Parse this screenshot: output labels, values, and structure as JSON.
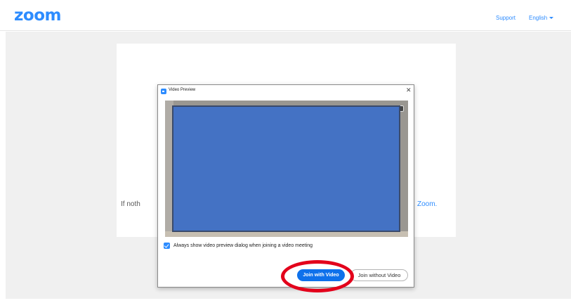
{
  "header": {
    "logo_text": "zoom",
    "support_link": "Support",
    "language_selector": "English"
  },
  "page": {
    "text_left_partial": "If noth",
    "text_right_partial": "Zoom."
  },
  "dialog": {
    "title": "Video Preview",
    "close_symbol": "✕",
    "checkbox": {
      "checked": true,
      "label": "Always show video preview dialog when joining a video meeting"
    },
    "buttons": {
      "join_with_video": "Join with Video",
      "join_without_video": "Join without Video"
    }
  },
  "colors": {
    "brand_blue": "#2d8cff",
    "primary_button": "#0e71eb",
    "redaction_block": "#4472c4",
    "annotation_red": "#e3001b",
    "backdrop_gray": "#f0f0f0"
  },
  "icons": {
    "dialog_app_icon": "zoom-app-icon",
    "close": "close-icon",
    "camera": "camera-switch-icon",
    "language_caret": "chevron-down-icon"
  }
}
